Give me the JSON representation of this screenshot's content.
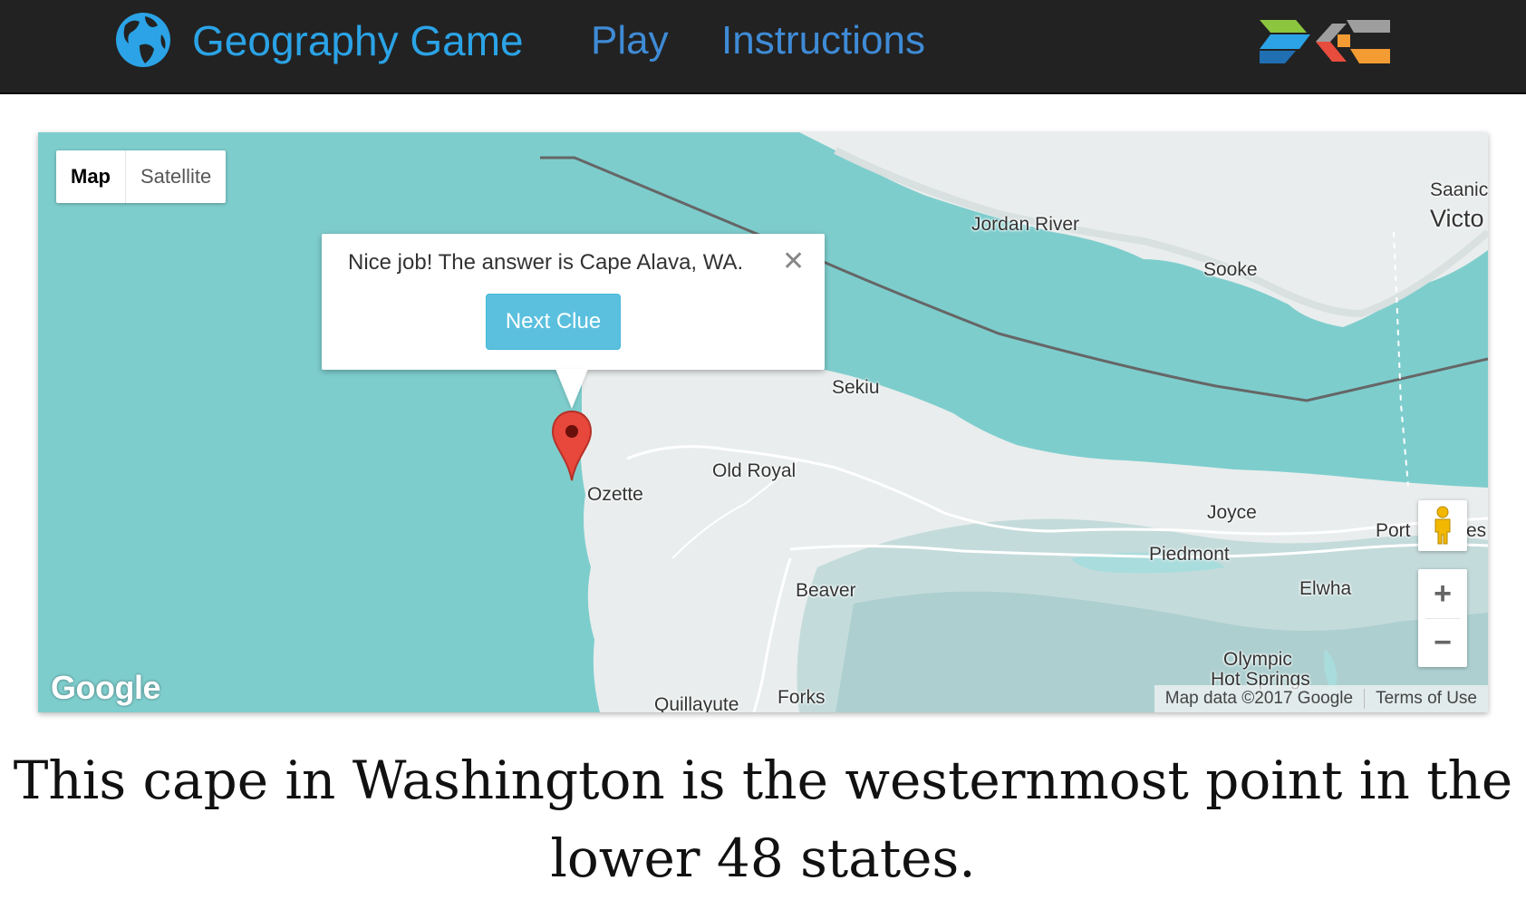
{
  "navbar": {
    "brand": "Geography Game",
    "links": [
      {
        "label": "Play"
      },
      {
        "label": "Instructions"
      }
    ],
    "brand_color": "#2ba3e6",
    "link_color": "#3f8bd6",
    "background": "#222222"
  },
  "map": {
    "type_controls": {
      "map_label": "Map",
      "satellite_label": "Satellite",
      "selected": "Map"
    },
    "place_labels": {
      "jordan_river": "Jordan River",
      "sooke": "Sooke",
      "saanich": "Saanic",
      "victoria": "Victo",
      "sekiu": "Sekiu",
      "old_royal": "Old Royal",
      "ozette": "Ozette",
      "joyce": "Joyce",
      "port": "Port",
      "port_suffix": "es",
      "piedmont": "Piedmont",
      "beaver": "Beaver",
      "elwha": "Elwha",
      "olympic": "Olympic",
      "hot_springs": "Hot Springs",
      "quillayute": "Quillayute",
      "forks": "Forks"
    },
    "info_window": {
      "message": "Nice job! The answer is Cape Alava, WA.",
      "close_symbol": "✕",
      "button_label": "Next Clue",
      "button_color": "#5bc0de"
    },
    "zoom": {
      "in": "+",
      "out": "−"
    },
    "logo": "Google",
    "attribution": {
      "data": "Map data ©2017 Google",
      "terms": "Terms of Use"
    },
    "marker_color": "#e8473c",
    "water_color": "#7ecdcd"
  },
  "clue": "This cape in Washington is the westernmost point in the lower 48 states."
}
